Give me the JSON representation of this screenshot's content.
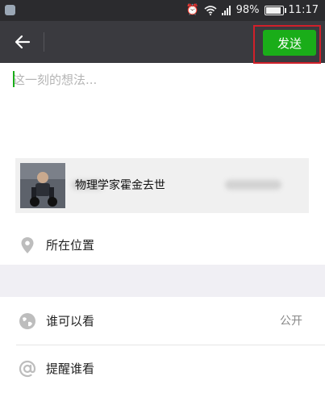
{
  "status_bar": {
    "battery": "98%",
    "time": "11:17"
  },
  "toolbar": {
    "send_label": "发送"
  },
  "compose": {
    "placeholder": "这一刻的想法..."
  },
  "link_card": {
    "title": "物理学家霍金去世"
  },
  "location": {
    "label": "所在位置"
  },
  "visibility": {
    "label": "谁可以看",
    "value": "公开"
  },
  "remind": {
    "label": "提醒谁看"
  },
  "colors": {
    "send_green": "#1aad19",
    "toolbar_bg": "#3a3a3f",
    "highlight_red": "#d0202a"
  },
  "icons": {
    "back": "arrow-left-icon",
    "location": "location-pin-icon",
    "visibility": "globe-icon",
    "remind": "at-sign-icon"
  }
}
